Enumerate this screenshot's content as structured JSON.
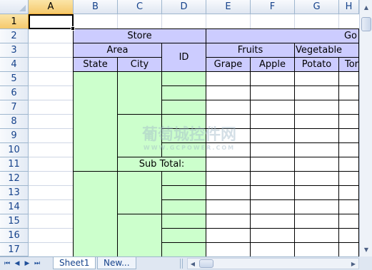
{
  "columns": [
    "A",
    "B",
    "C",
    "D",
    "E",
    "F",
    "G",
    "H"
  ],
  "selected_column": "A",
  "rows": [
    "1",
    "2",
    "3",
    "4",
    "5",
    "6",
    "7",
    "8",
    "9",
    "10",
    "11",
    "12",
    "13",
    "14",
    "15",
    "16",
    "17"
  ],
  "selected_row": "1",
  "table": {
    "store": "Store",
    "goods": "Go",
    "area": "Area",
    "id": "ID",
    "fruits": "Fruits",
    "vegetables": "Vegetable",
    "state": "State",
    "city": "City",
    "grape": "Grape",
    "apple": "Apple",
    "potato": "Potato",
    "tomato": "Tor",
    "subtotal": "Sub Total:"
  },
  "sheets": {
    "tabs": [
      "Sheet1",
      "New..."
    ],
    "active": "Sheet1"
  },
  "watermark": {
    "main": "葡萄城控件网",
    "sub": "WWW.GCPOWER.COM"
  },
  "colors": {
    "header_fill": "#ccccff",
    "body_fill": "#ccffcc",
    "selection": "#f5c96c"
  }
}
